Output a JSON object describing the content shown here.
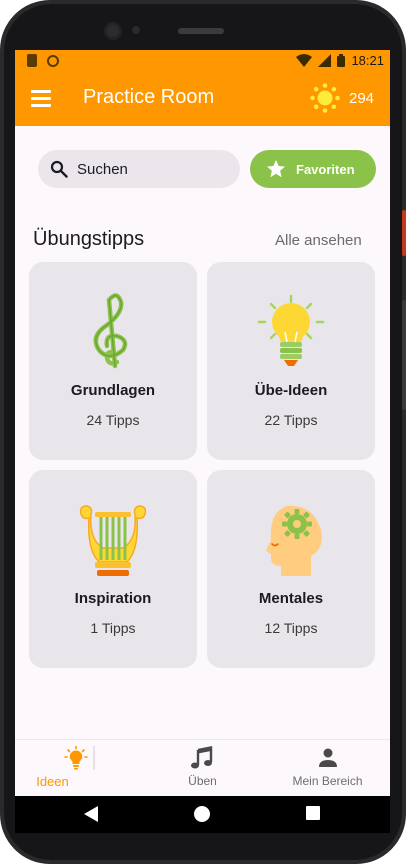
{
  "status_bar": {
    "time": "18:21",
    "icons": [
      "notification-icon",
      "sync-icon",
      "wifi-icon",
      "signal-icon",
      "battery-icon"
    ]
  },
  "app_bar": {
    "title": "Practice Room",
    "points": "294",
    "menu_icon": "hamburger-menu-icon",
    "points_icon": "sun-icon"
  },
  "search": {
    "placeholder": "Suchen",
    "icon": "search-icon"
  },
  "favorites_button": {
    "label": "Favoriten",
    "icon": "star-icon"
  },
  "section": {
    "title": "Übungstipps",
    "see_all": "Alle ansehen"
  },
  "cards": [
    {
      "title": "Grundlagen",
      "subtitle": "24 Tipps",
      "icon": "treble-clef-icon"
    },
    {
      "title": "Übe-Ideen",
      "subtitle": "22 Tipps",
      "icon": "light-bulb-icon"
    },
    {
      "title": "Inspiration",
      "subtitle": "1 Tipps",
      "icon": "lyre-icon"
    },
    {
      "title": "Mentales",
      "subtitle": "12 Tipps",
      "icon": "head-gear-icon"
    }
  ],
  "bottom_nav": [
    {
      "label": "Ideen",
      "icon": "light-bulb-icon",
      "active": true
    },
    {
      "label": "Üben",
      "icon": "music-note-icon",
      "active": false
    },
    {
      "label": "Mein Bereich",
      "icon": "person-icon",
      "active": false
    }
  ],
  "colors": {
    "primary": "#ff9800",
    "accent": "#8bc34a",
    "card_bg": "#e8e6ea",
    "background": "#fcf8fc"
  }
}
